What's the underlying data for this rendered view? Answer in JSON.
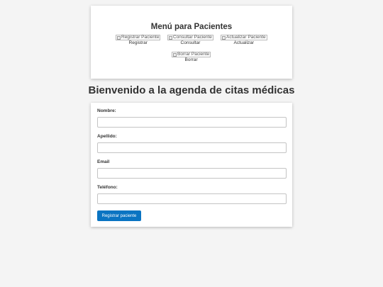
{
  "menu": {
    "title": "Menú para Pacientes",
    "items": [
      {
        "alt": "Registrar Paciente",
        "label": "Registrar"
      },
      {
        "alt": "Consultar Paciente",
        "label": "Consultar"
      },
      {
        "alt": "Actualizar Paciente",
        "label": "Actualizar"
      },
      {
        "alt": "Borrar Paciente",
        "label": "Borrar"
      }
    ]
  },
  "heading": "Bienvenido a la agenda de citas médicas",
  "form": {
    "fields": [
      {
        "label": "Nombre:",
        "value": ""
      },
      {
        "label": "Apellido:",
        "value": ""
      },
      {
        "label": "Email",
        "value": ""
      },
      {
        "label": "Teléfono:",
        "value": ""
      }
    ],
    "submit_label": "Registrar paciente"
  },
  "colors": {
    "background": "#f4f4f4",
    "accent": "#0a74c2"
  }
}
